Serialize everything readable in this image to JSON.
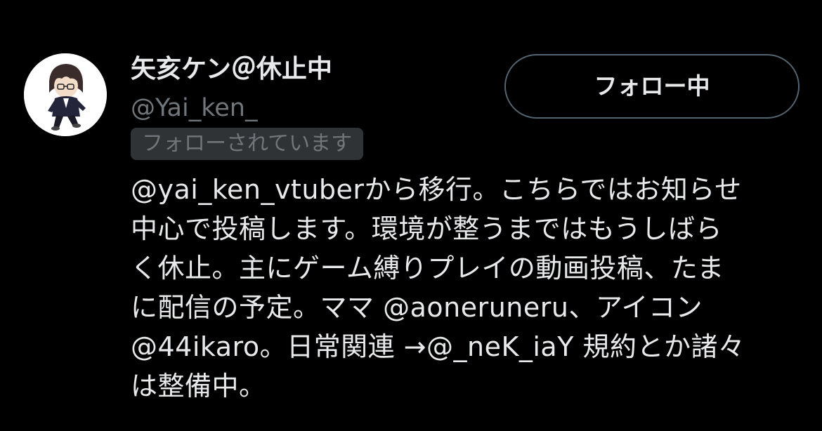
{
  "profile": {
    "display_name": "矢亥ケン＠休止中",
    "handle": "@Yai_ken_",
    "follows_you_badge": "フォローされています",
    "follow_button_label": "フォロー中",
    "avatar_icon": "avatar-illustration"
  },
  "bio": {
    "lines": [
      "@yai_ken_vtuberから移行。こちらではお知らせ",
      "中心で投稿します。環境が整うまではもうしばら",
      "く休止。主にゲーム縛りプレイの動画投稿、たま",
      "に配信の予定。ママ @aoneruneru、アイコン",
      "@44ikaro。日常関連 →@_neK_iaY 規約とか諸々",
      "は整備中。"
    ]
  },
  "colors": {
    "background": "#000000",
    "primary_text": "#e7e9ea",
    "secondary_text": "#71767b",
    "badge_background": "#2f3336",
    "button_border": "#536471"
  }
}
